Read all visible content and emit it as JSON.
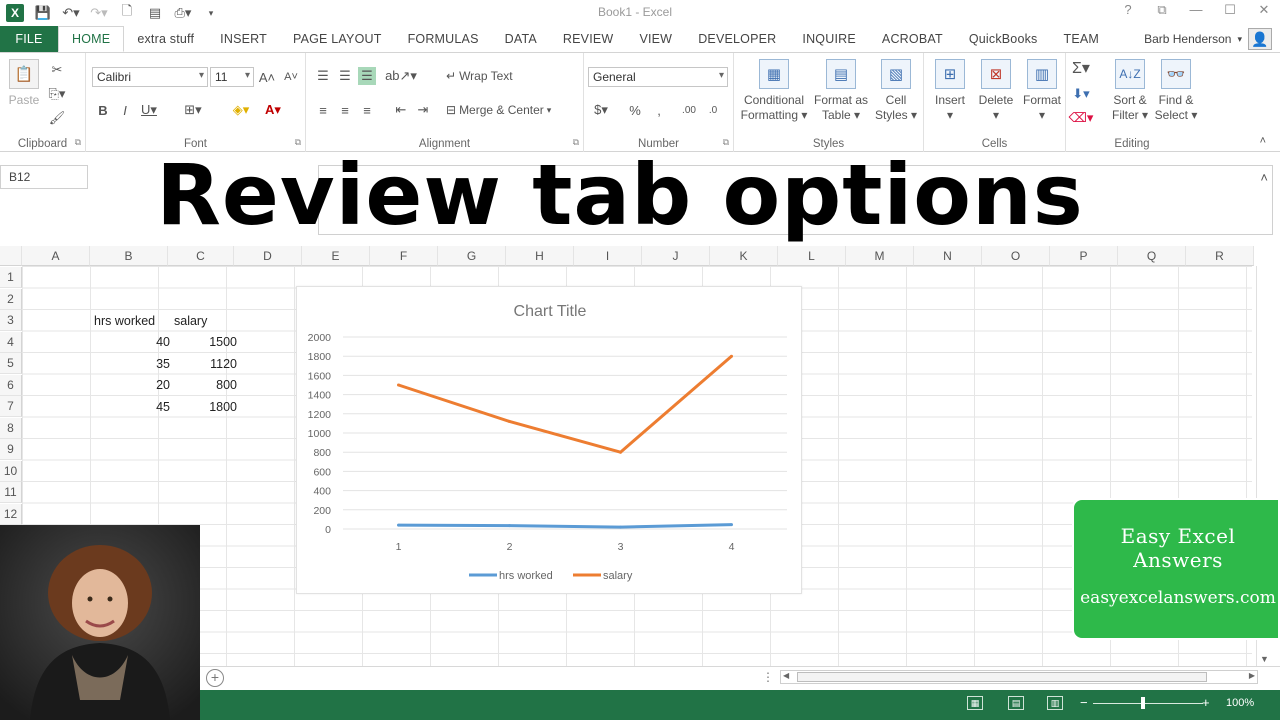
{
  "window": {
    "title": "Book1 - Excel",
    "user": "Barb Henderson"
  },
  "tabs": [
    {
      "label": "FILE"
    },
    {
      "label": "HOME"
    },
    {
      "label": "extra stuff"
    },
    {
      "label": "INSERT"
    },
    {
      "label": "PAGE LAYOUT"
    },
    {
      "label": "FORMULAS"
    },
    {
      "label": "DATA"
    },
    {
      "label": "REVIEW"
    },
    {
      "label": "VIEW"
    },
    {
      "label": "DEVELOPER"
    },
    {
      "label": "INQUIRE"
    },
    {
      "label": "ACROBAT"
    },
    {
      "label": "QuickBooks"
    },
    {
      "label": "TEAM"
    }
  ],
  "ribbon": {
    "clipboard": {
      "label": "Clipboard",
      "paste": "Paste"
    },
    "font": {
      "label": "Font",
      "name": "Calibri",
      "size": "11"
    },
    "alignment": {
      "label": "Alignment",
      "wrap": "Wrap Text",
      "merge": "Merge & Center"
    },
    "number": {
      "label": "Number",
      "format": "General"
    },
    "styles": {
      "label": "Styles",
      "cond1": "Conditional",
      "cond2": "Formatting",
      "fmt1": "Format as",
      "fmt2": "Table",
      "cell1": "Cell",
      "cell2": "Styles"
    },
    "cells": {
      "label": "Cells",
      "insert": "Insert",
      "delete": "Delete",
      "format": "Format"
    },
    "editing": {
      "label": "Editing",
      "sort1": "Sort &",
      "sort2": "Filter",
      "find1": "Find &",
      "find2": "Select"
    }
  },
  "name_box": "B12",
  "overlay_title": "Review tab options",
  "columns": [
    "A",
    "B",
    "C",
    "D",
    "E",
    "F",
    "G",
    "H",
    "I",
    "J",
    "K",
    "L",
    "M",
    "N",
    "O",
    "P",
    "Q",
    "R"
  ],
  "rows": [
    "1",
    "2",
    "3",
    "4",
    "5",
    "6",
    "7",
    "8",
    "9",
    "10",
    "11",
    "12"
  ],
  "cells": {
    "b3": "hrs worked",
    "c3": "salary",
    "b4": "40",
    "c4": "1500",
    "b5": "35",
    "c5": "1120",
    "b6": "20",
    "c6": "800",
    "b7": "45",
    "c7": "1800"
  },
  "chart_data": {
    "type": "line",
    "title": "Chart Title",
    "categories": [
      "1",
      "2",
      "3",
      "4"
    ],
    "series": [
      {
        "name": "hrs worked",
        "values": [
          40,
          35,
          20,
          45
        ],
        "color": "#5b9bd5"
      },
      {
        "name": "salary",
        "values": [
          1500,
          1120,
          800,
          1800
        ],
        "color": "#ed7d31"
      }
    ],
    "ylim": [
      0,
      2000
    ],
    "yticks": [
      "0",
      "200",
      "400",
      "600",
      "800",
      "1000",
      "1200",
      "1400",
      "1600",
      "1800",
      "2000"
    ],
    "grid": true,
    "legend": "bottom"
  },
  "status": {
    "zoom": "100%"
  },
  "brand": {
    "name": "Easy Excel Answers",
    "url": "easyexcelanswers.com"
  },
  "colors": {
    "excel_green": "#217346",
    "brand_green": "#2eb94a"
  }
}
